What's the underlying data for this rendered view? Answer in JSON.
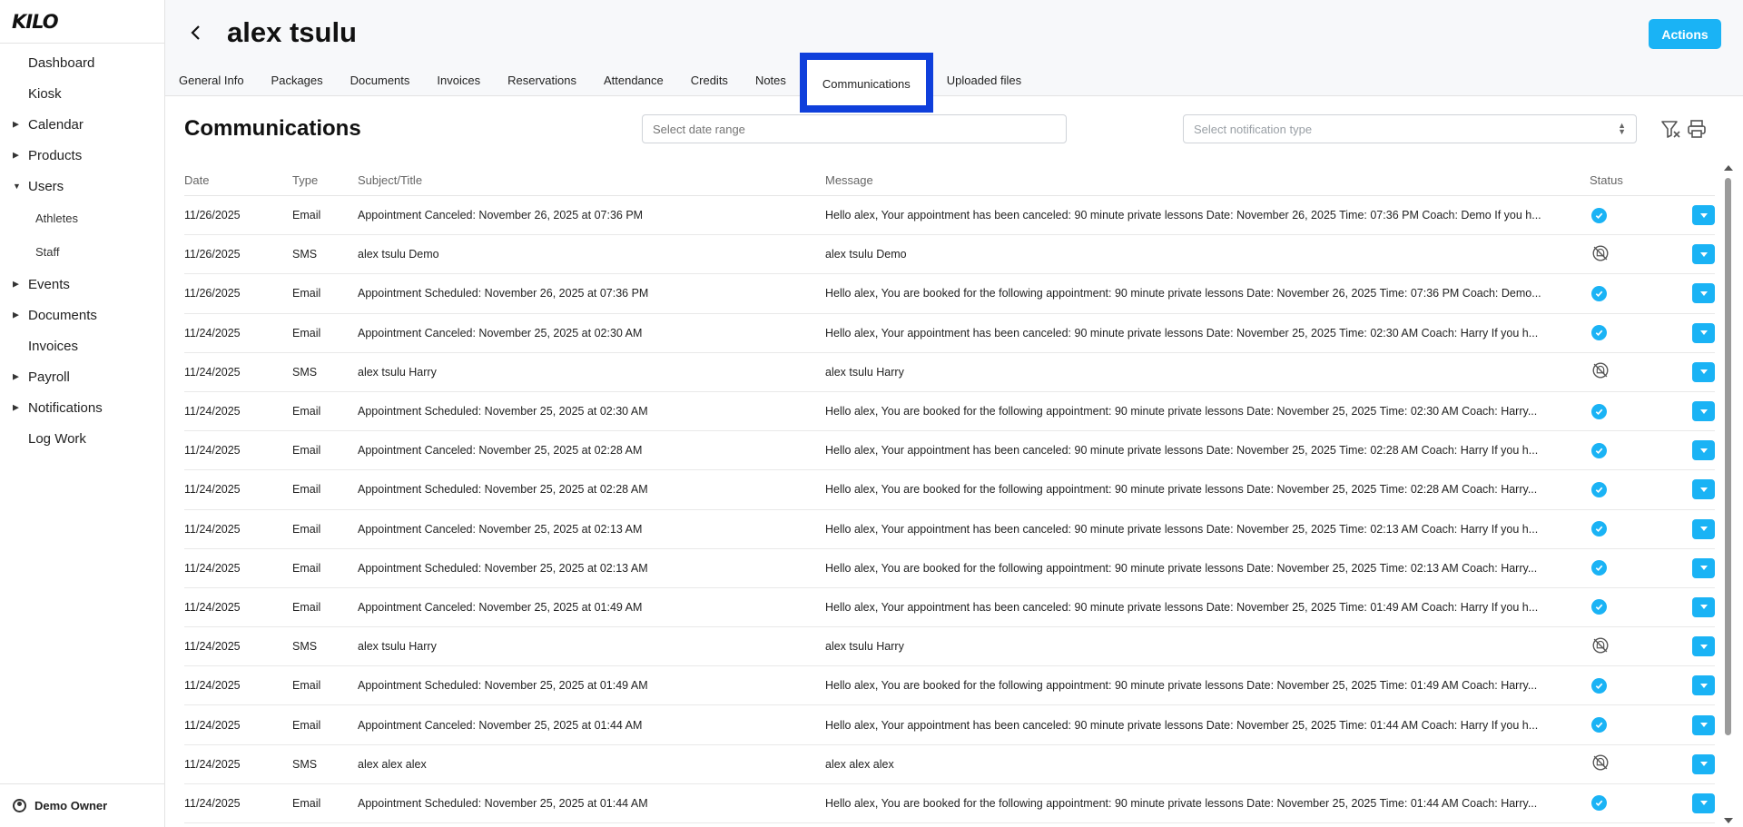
{
  "sidebar": {
    "logo": "KILO",
    "items": [
      {
        "label": "Dashboard",
        "expandable": false
      },
      {
        "label": "Kiosk",
        "expandable": false
      },
      {
        "label": "Calendar",
        "expandable": true
      },
      {
        "label": "Products",
        "expandable": true
      },
      {
        "label": "Users",
        "expandable": true,
        "expanded": true,
        "children": [
          "Athletes",
          "Staff"
        ]
      },
      {
        "label": "Events",
        "expandable": true
      },
      {
        "label": "Documents",
        "expandable": true
      },
      {
        "label": "Invoices",
        "expandable": false
      },
      {
        "label": "Payroll",
        "expandable": true
      },
      {
        "label": "Notifications",
        "expandable": true
      },
      {
        "label": "Log Work",
        "expandable": false
      }
    ],
    "user_name": "Demo Owner"
  },
  "header": {
    "title": "alex tsulu",
    "actions_label": "Actions",
    "tabs": [
      "General Info",
      "Packages",
      "Documents",
      "Invoices",
      "Reservations",
      "Attendance",
      "Credits",
      "Notes",
      "Communications",
      "Uploaded files"
    ],
    "active_tab": "Communications"
  },
  "main": {
    "section_title": "Communications",
    "date_placeholder": "Select date range",
    "type_placeholder": "Select notification type",
    "columns": [
      "Date",
      "Type",
      "Subject/Title",
      "Message",
      "Status"
    ],
    "rows": [
      {
        "date": "11/26/2025",
        "type": "Email",
        "subject": "Appointment Canceled: November 26, 2025 at 07:36 PM",
        "message": "Hello alex, Your appointment has been canceled: 90 minute private lessons Date: November 26, 2025 Time: 07:36 PM Coach: Demo If you h...",
        "status": "sent"
      },
      {
        "date": "11/26/2025",
        "type": "SMS",
        "subject": "alex tsulu Demo",
        "message": "alex tsulu Demo",
        "status": "not-sent"
      },
      {
        "date": "11/26/2025",
        "type": "Email",
        "subject": "Appointment Scheduled: November 26, 2025 at 07:36 PM",
        "message": "Hello alex, You are booked for the following appointment: 90 minute private lessons Date: November 26, 2025 Time: 07:36 PM Coach: Demo...",
        "status": "sent"
      },
      {
        "date": "11/24/2025",
        "type": "Email",
        "subject": "Appointment Canceled: November 25, 2025 at 02:30 AM",
        "message": "Hello alex, Your appointment has been canceled: 90 minute private lessons Date: November 25, 2025 Time: 02:30 AM Coach: Harry If you h...",
        "status": "sent"
      },
      {
        "date": "11/24/2025",
        "type": "SMS",
        "subject": "alex tsulu Harry",
        "message": "alex tsulu Harry",
        "status": "not-sent"
      },
      {
        "date": "11/24/2025",
        "type": "Email",
        "subject": "Appointment Scheduled: November 25, 2025 at 02:30 AM",
        "message": "Hello alex, You are booked for the following appointment: 90 minute private lessons Date: November 25, 2025 Time: 02:30 AM Coach: Harry...",
        "status": "sent"
      },
      {
        "date": "11/24/2025",
        "type": "Email",
        "subject": "Appointment Canceled: November 25, 2025 at 02:28 AM",
        "message": "Hello alex, Your appointment has been canceled: 90 minute private lessons Date: November 25, 2025 Time: 02:28 AM Coach: Harry If you h...",
        "status": "sent"
      },
      {
        "date": "11/24/2025",
        "type": "Email",
        "subject": "Appointment Scheduled: November 25, 2025 at 02:28 AM",
        "message": "Hello alex, You are booked for the following appointment: 90 minute private lessons Date: November 25, 2025 Time: 02:28 AM Coach: Harry...",
        "status": "sent"
      },
      {
        "date": "11/24/2025",
        "type": "Email",
        "subject": "Appointment Canceled: November 25, 2025 at 02:13 AM",
        "message": "Hello alex, Your appointment has been canceled: 90 minute private lessons Date: November 25, 2025 Time: 02:13 AM Coach: Harry If you h...",
        "status": "sent"
      },
      {
        "date": "11/24/2025",
        "type": "Email",
        "subject": "Appointment Scheduled: November 25, 2025 at 02:13 AM",
        "message": "Hello alex, You are booked for the following appointment: 90 minute private lessons Date: November 25, 2025 Time: 02:13 AM Coach: Harry...",
        "status": "sent"
      },
      {
        "date": "11/24/2025",
        "type": "Email",
        "subject": "Appointment Canceled: November 25, 2025 at 01:49 AM",
        "message": "Hello alex, Your appointment has been canceled: 90 minute private lessons Date: November 25, 2025 Time: 01:49 AM Coach: Harry If you h...",
        "status": "sent"
      },
      {
        "date": "11/24/2025",
        "type": "SMS",
        "subject": "alex tsulu Harry",
        "message": "alex tsulu Harry",
        "status": "not-sent"
      },
      {
        "date": "11/24/2025",
        "type": "Email",
        "subject": "Appointment Scheduled: November 25, 2025 at 01:49 AM",
        "message": "Hello alex, You are booked for the following appointment: 90 minute private lessons Date: November 25, 2025 Time: 01:49 AM Coach: Harry...",
        "status": "sent"
      },
      {
        "date": "11/24/2025",
        "type": "Email",
        "subject": "Appointment Canceled: November 25, 2025 at 01:44 AM",
        "message": "Hello alex, Your appointment has been canceled: 90 minute private lessons Date: November 25, 2025 Time: 01:44 AM Coach: Harry If you h...",
        "status": "sent"
      },
      {
        "date": "11/24/2025",
        "type": "SMS",
        "subject": "alex alex alex",
        "message": "alex alex alex",
        "status": "not-sent"
      },
      {
        "date": "11/24/2025",
        "type": "Email",
        "subject": "Appointment Scheduled: November 25, 2025 at 01:44 AM",
        "message": "Hello alex, You are booked for the following appointment: 90 minute private lessons Date: November 25, 2025 Time: 01:44 AM Coach: Harry...",
        "status": "sent"
      }
    ]
  },
  "icons": {
    "back": "chevron-left-icon",
    "filter_clear": "filter-clear-icon",
    "print": "printer-icon",
    "status_sent": "check-circle-icon",
    "status_not_sent": "bell-off-icon",
    "row_menu": "chevron-down-icon",
    "user": "user-circle-icon"
  },
  "colors": {
    "accent": "#1ab3f5",
    "highlight": "#0f3fdb"
  }
}
